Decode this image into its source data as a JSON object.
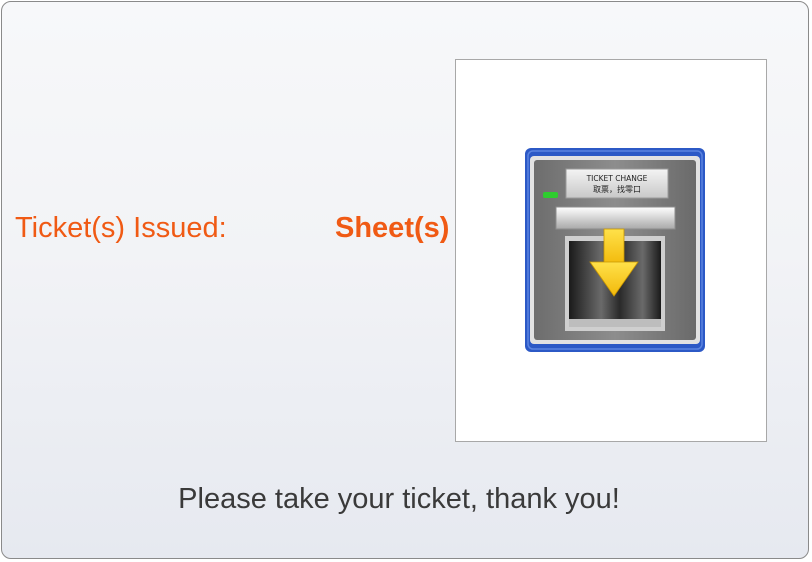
{
  "issued": {
    "label": "Ticket(s) Issued:",
    "count": "",
    "unit": "Sheet(s)"
  },
  "machine": {
    "title": "TICKET CHANGE",
    "subtitle": "取票，找零口"
  },
  "message": {
    "thanks": "Please take your ticket, thank you!"
  },
  "colors": {
    "accent": "#f05a14",
    "machine_frame": "#2c59c6",
    "indicator_green": "#2ecc2e",
    "arrow_yellow": "#f7d21c"
  },
  "icons": {
    "machine": "ticket-dispenser-icon",
    "arrow": "arrow-down-icon"
  }
}
